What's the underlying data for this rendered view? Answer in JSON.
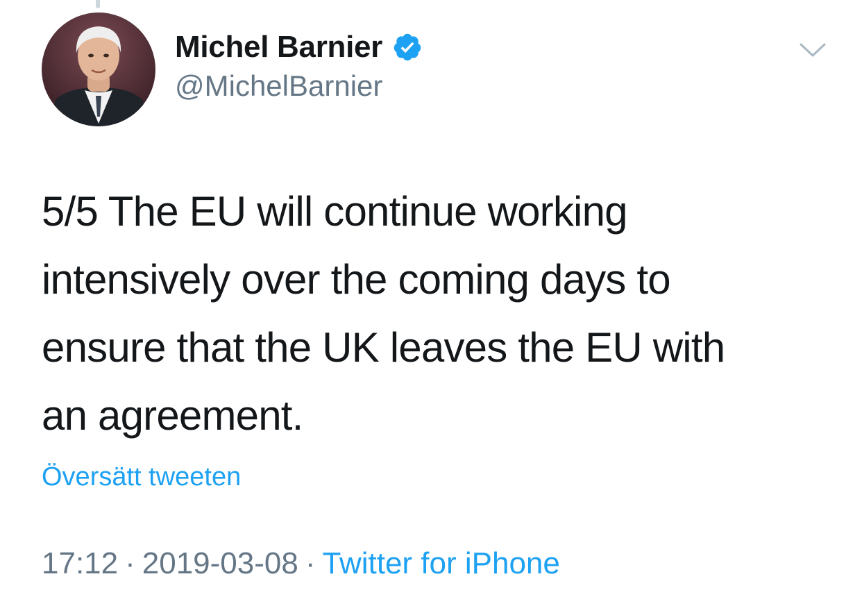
{
  "author": {
    "display_name": "Michel Barnier",
    "handle": "@MichelBarnier",
    "verified": true,
    "avatar_icon": "profile-photo"
  },
  "tweet": {
    "text_lines": [
      "5/5 The EU will continue working",
      "intensively over the coming days to",
      "ensure that the UK leaves the EU with",
      "an agreement."
    ],
    "translate_label": "Översätt tweeten",
    "time": "17:12",
    "date": "2019-03-08",
    "separator": "·",
    "source": "Twitter for iPhone"
  },
  "icons": {
    "verified": "verified-badge-icon",
    "menu": "chevron-down-icon"
  },
  "colors": {
    "text": "#14171a",
    "secondary": "#657786",
    "accent": "#1da1f2",
    "thread_line": "#ccd6dd"
  }
}
